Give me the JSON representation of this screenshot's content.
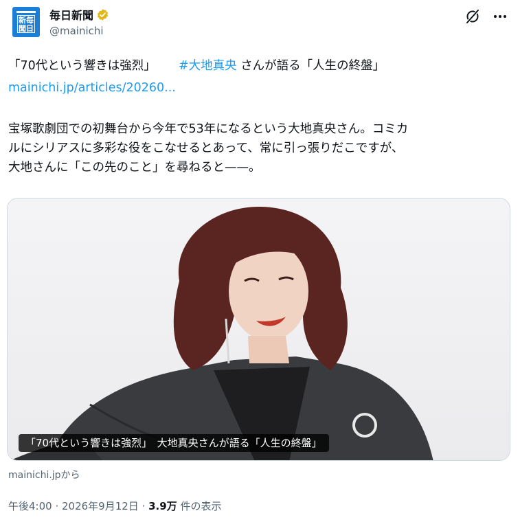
{
  "account": {
    "display_name": "毎日新聞",
    "handle": "@mainichi",
    "avatar_logo_text": [
      "新",
      "毎",
      "聞",
      "日"
    ],
    "verified_color": "#e2b719"
  },
  "tweet": {
    "line1_part1": "「70代という響きは強烈」",
    "hashtag": "#大地真央",
    "line1_part2": " さんが語る「人生の終盤」",
    "link": "mainichi.jp/articles/20260...",
    "body_lines": [
      "宝塚歌劇団での初舞台から今年で53年になるという大地真央さん。コミカ",
      "ルにシリアスに多彩な役をこなせるとあって、常に引っ張りだこですが、",
      "大地さんに「この先のこと」を尋ねると——。"
    ]
  },
  "card": {
    "caption": "「70代という響きは強烈」　大地真央さんが語る「人生の終盤」",
    "source": "mainichi.jpから"
  },
  "meta": {
    "time": "午後4:00 · 2026年9月12日 · ",
    "views": "3.9万",
    "views_suffix": " 件の表示"
  },
  "icons": {
    "grok": "grok-icon",
    "more": "more-icon",
    "verified": "verified-badge-icon"
  },
  "colors": {
    "link": "#1d9bf0",
    "secondary_text": "#536471",
    "avatar_bg": "#1d7ed6"
  }
}
